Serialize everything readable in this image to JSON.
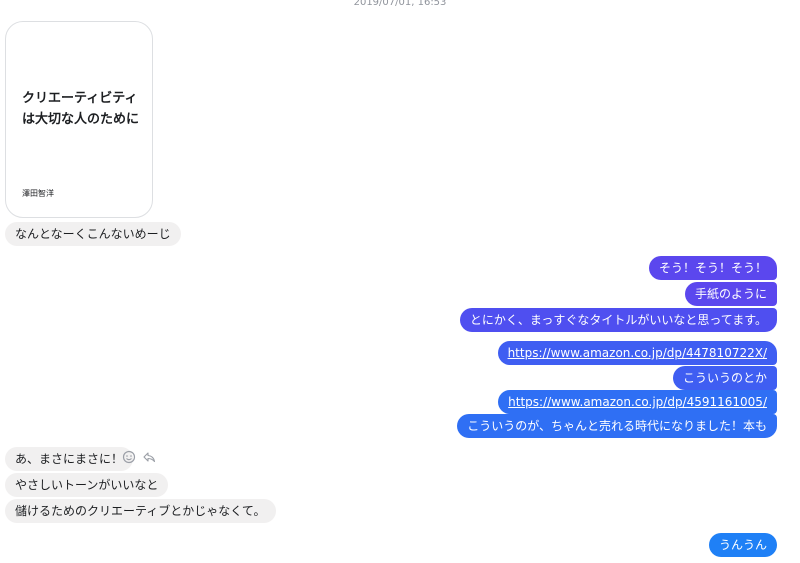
{
  "thread": {
    "timestamp": "2019/07/01, 16:53"
  },
  "card": {
    "title": "クリエーティビティは大切な人のために",
    "author": "澤田智洋"
  },
  "messages": {
    "m1": "なんとなーくこんないめーじ",
    "m2": "そう！そう！そう！",
    "m3": "手紙のように",
    "m4": "とにかく、まっすぐなタイトルがいいなと思ってます。",
    "m5": "https://www.amazon.co.jp/dp/447810722X/",
    "m6": "こういうのとか",
    "m7": "https://www.amazon.co.jp/dp/4591161005/",
    "m8": "こういうのが、ちゃんと売れる時代になりました！本も",
    "m9": "あ、まさにまさに！",
    "m10": "やさしいトーンがいいなと",
    "m11": "儲けるためのクリエーティブとかじゃなくて。",
    "m12": "うんうん"
  },
  "icons": {
    "react": "smiley-icon",
    "reply": "reply-icon"
  }
}
